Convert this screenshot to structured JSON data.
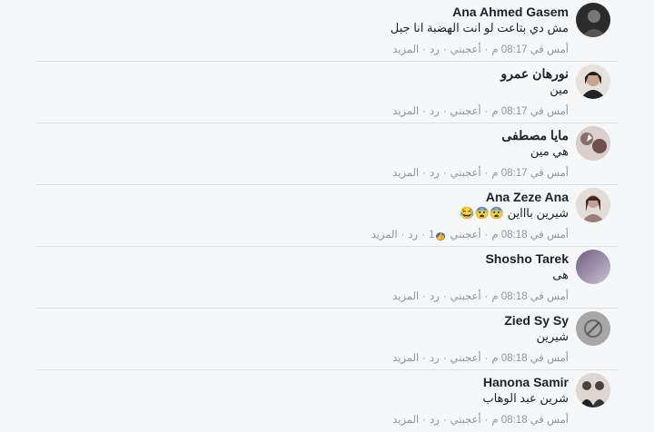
{
  "comments": [
    {
      "author": "Ana Ahmed Gasem",
      "text": "مش دي بتاعت لو انت الهضبة انا جبل",
      "time": "أمس في 08:17 م",
      "like": "أعجبني",
      "reply": "رد",
      "more": "المزيد",
      "avatar_color": "#2b2b2b"
    },
    {
      "author": "نورهان عمرو",
      "text": "مين",
      "time": "أمس في 08:17 م",
      "like": "أعجبني",
      "reply": "رد",
      "more": "المزيد",
      "avatar_color": "#6b4a3a"
    },
    {
      "author": "مايا مصطفى",
      "text": "هي مين",
      "time": "أمس في 08:17 م",
      "like": "أعجبني",
      "reply": "رد",
      "more": "المزيد",
      "avatar_color": "#8a6d6a"
    },
    {
      "author": "Ana Zeze Ana",
      "text": "شيرين باااين",
      "emojis": "😨😨😂",
      "time": "أمس في 08:18 م",
      "like": "أعجبني",
      "like_count": "1",
      "reply": "رد",
      "more": "المزيد",
      "avatar_color": "#9c7d78"
    },
    {
      "author": "Shosho Tarek",
      "text": "هى",
      "time": "أمس في 08:18 م",
      "like": "أعجبني",
      "reply": "رد",
      "more": "المزيد",
      "avatar_color": "#8f86a6"
    },
    {
      "author": "Zied Sy Sy",
      "text": "شيرين",
      "time": "أمس في 08:18 م",
      "like": "أعجبني",
      "reply": "رد",
      "more": "المزيد",
      "avatar_color": "#a7a7a7"
    },
    {
      "author": "Hanona Samir",
      "text": "شرين عبد الوهاب",
      "time": "أمس في 08:18 م",
      "like": "أعجبني",
      "reply": "رد",
      "more": "المزيد",
      "avatar_color": "#4d4040"
    }
  ],
  "colors": {
    "background": "#f6f7f9",
    "author": "#1d2129",
    "meta": "#90949c",
    "like_badge": "#4267b2"
  }
}
